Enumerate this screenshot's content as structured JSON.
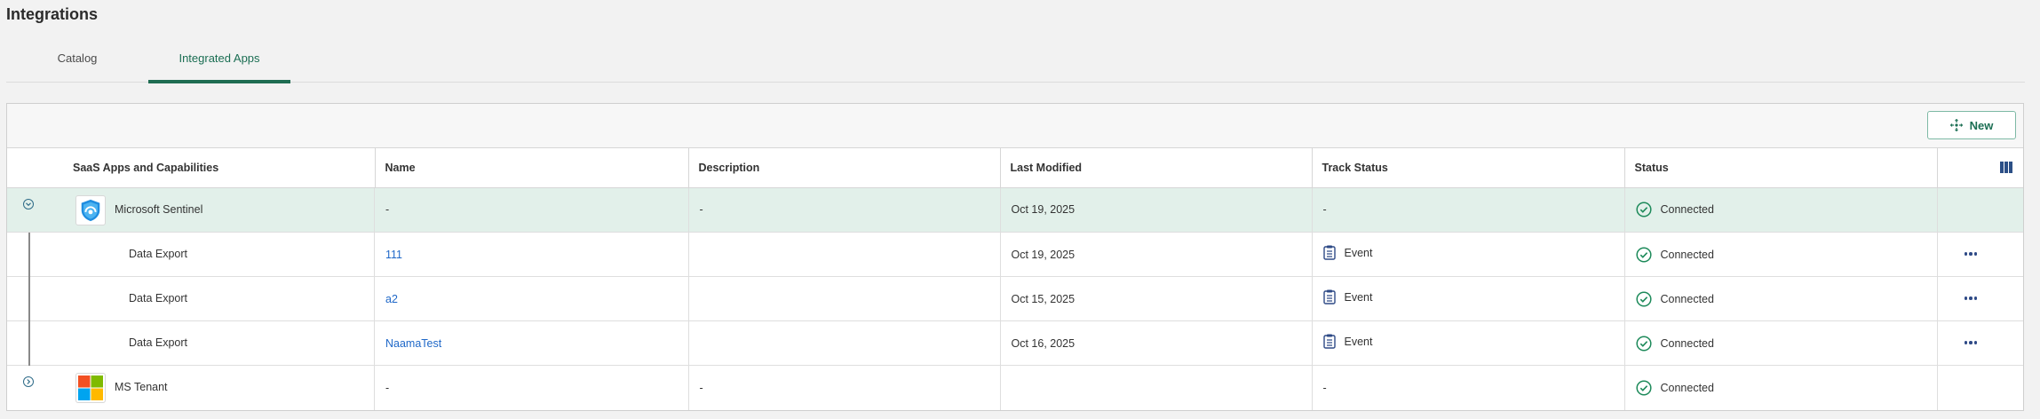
{
  "page": {
    "title": "Integrations"
  },
  "tabs": [
    {
      "label": "Catalog",
      "active": false
    },
    {
      "label": "Integrated Apps",
      "active": true
    }
  ],
  "toolbar": {
    "new_label": "New",
    "new_icon": "plus-move-icon"
  },
  "table": {
    "headers": [
      "SaaS Apps and Capabilities",
      "Name",
      "Description",
      "Last Modified",
      "Track Status",
      "Status"
    ],
    "columns_icon": "columns-icon",
    "rows": [
      {
        "app": "Microsoft Sentinel",
        "name": "-",
        "description": "-",
        "last_modified": "Oct 19, 2025",
        "track_status": "-",
        "status": "Connected",
        "expanded": true
      },
      {
        "app": "Data Export",
        "name": "111",
        "description": "",
        "last_modified": "Oct 19, 2025",
        "track_status": "Event",
        "status": "Connected"
      },
      {
        "app": "Data Export",
        "name": "a2",
        "description": "",
        "last_modified": "Oct 15, 2025",
        "track_status": "Event",
        "status": "Connected"
      },
      {
        "app": "Data Export",
        "name": "NaamaTest",
        "description": "",
        "last_modified": "Oct 16, 2025",
        "track_status": "Event",
        "status": "Connected"
      },
      {
        "app": "MS Tenant",
        "name": "-",
        "description": "-",
        "last_modified": "",
        "track_status": "-",
        "status": "Connected",
        "expanded": false
      }
    ]
  },
  "colors": {
    "accent": "#1f6d52",
    "selected_row": "#e2f0ea",
    "link": "#1f68c8",
    "status_ok": "#1d8a5a"
  }
}
